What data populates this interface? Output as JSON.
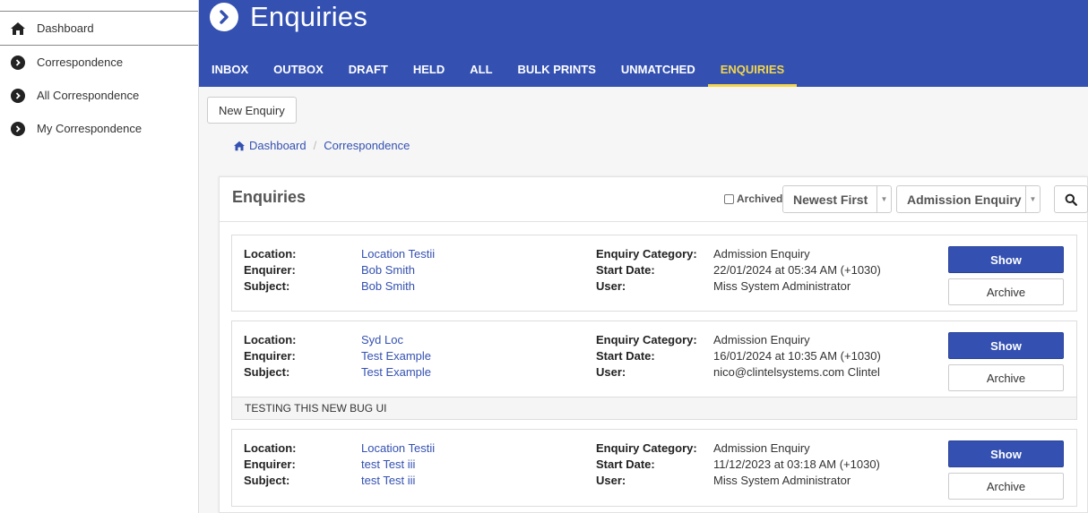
{
  "sidebar": {
    "items": [
      {
        "label": "Dashboard",
        "icon": "home-icon"
      },
      {
        "label": "Correspondence",
        "icon": "chevron-circle-right-icon"
      },
      {
        "label": "All Correspondence",
        "icon": "chevron-circle-right-icon"
      },
      {
        "label": "My Correspondence",
        "icon": "chevron-circle-right-icon"
      }
    ]
  },
  "header": {
    "title": "Enquiries",
    "tabs": [
      "INBOX",
      "OUTBOX",
      "DRAFT",
      "HELD",
      "ALL",
      "BULK PRINTS",
      "UNMATCHED",
      "ENQUIRIES"
    ],
    "active_tab": "ENQUIRIES",
    "colors": {
      "bar": "#3451b2",
      "active_tab": "#f3d64b"
    }
  },
  "toolbar": {
    "new_label": "New Enquiry"
  },
  "breadcrumb": [
    "Dashboard",
    "Correspondence"
  ],
  "panel": {
    "title": "Enquiries",
    "archived_label": "Archived",
    "archived_checked": false,
    "sort_value": "Newest First",
    "category_value": "Admission Enquiry"
  },
  "labels": {
    "location": "Location:",
    "enquirer": "Enquirer:",
    "subject": "Subject:",
    "category": "Enquiry Category:",
    "start_date": "Start Date:",
    "user": "User:",
    "show": "Show",
    "archive": "Archive"
  },
  "enquiries": [
    {
      "location": "Location Testii",
      "enquirer": "Bob Smith",
      "subject": "Bob Smith",
      "category": "Admission Enquiry",
      "start_date": "22/01/2024 at 05:34 AM (+1030)",
      "user": "Miss System Administrator",
      "note": ""
    },
    {
      "location": "Syd Loc",
      "enquirer": "Test Example",
      "subject": "Test Example",
      "category": "Admission Enquiry",
      "start_date": "16/01/2024 at 10:35 AM (+1030)",
      "user": "nico@clintelsystems.com Clintel",
      "note": "TESTING THIS NEW BUG UI"
    },
    {
      "location": "Location Testii",
      "enquirer": "test Test iii",
      "subject": "test Test iii",
      "category": "Admission Enquiry",
      "start_date": "11/12/2023 at 03:18 AM (+1030)",
      "user": "Miss System Administrator",
      "note": ""
    }
  ]
}
